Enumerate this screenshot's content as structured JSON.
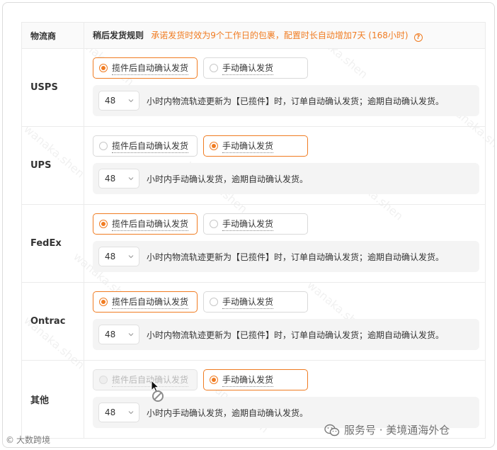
{
  "header": {
    "carrier_col": "物流商",
    "rule_col": "稍后发货规则",
    "hint": "承诺发货时效为9个工作日的包裹，配置时长自动增加7天 (168小时)",
    "help_icon": "question-circle-icon"
  },
  "rows": [
    {
      "carrier": "USPS",
      "option_a": "揽件后自动确认发货",
      "option_b": "手动确认发货",
      "selected": "a",
      "hours": "48",
      "text": "小时内物流轨迹更新为【已揽件】时，订单自动确认发货；逾期自动确认发货。"
    },
    {
      "carrier": "UPS",
      "option_a": "揽件后自动确认发货",
      "option_b": "手动确认发货",
      "selected": "b",
      "hours": "48",
      "text": "小时内手动确认发货，逾期自动确认发货。"
    },
    {
      "carrier": "FedEx",
      "option_a": "揽件后自动确认发货",
      "option_b": "手动确认发货",
      "selected": "a",
      "hours": "48",
      "text": "小时内物流轨迹更新为【已揽件】时，订单自动确认发货；逾期自动确认发货。"
    },
    {
      "carrier": "Ontrac",
      "option_a": "揽件后自动确认发货",
      "option_b": "手动确认发货",
      "selected": "a",
      "hours": "48",
      "text": "小时内物流轨迹更新为【已揽件】时，订单自动确认发货；逾期自动确认发货。"
    },
    {
      "carrier": "其他",
      "option_a": "揽件后自动确认发货",
      "option_b": "手动确认发货",
      "selected": "b",
      "option_a_disabled": true,
      "hours": "48",
      "text": "小时内手动确认发货，逾期自动确认发货。"
    }
  ],
  "watermark": "wanaka.shen",
  "footer": {
    "left_brand": "大数跨境",
    "right_brand": "服务号 · 美境通海外仓"
  },
  "colors": {
    "accent": "#f07c22",
    "border": "#ebebeb",
    "config_bg": "#f4f4f4"
  }
}
